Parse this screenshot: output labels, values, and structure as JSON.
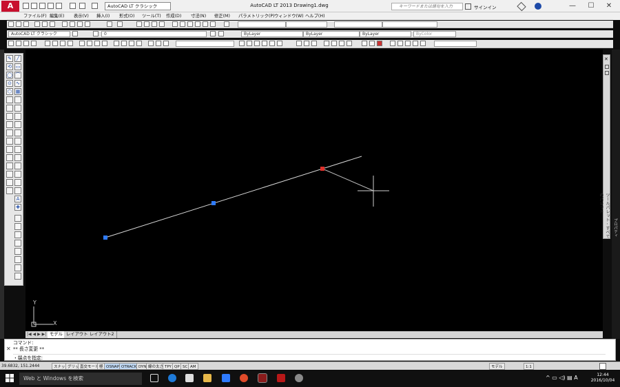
{
  "app": {
    "logo_label": "A",
    "workspace": "AutoCAD LT クラシック",
    "window_title": "AutoCAD LT 2013    Drawing1.dwg",
    "search_placeholder": "キーワードまたは語句を入力",
    "signin": "サインイン",
    "window_controls": [
      "—",
      "☐",
      "✕"
    ]
  },
  "menu": [
    "ファイル(F)",
    "編集(E)",
    "表示(V)",
    "挿入(I)",
    "形式(O)",
    "ツール(T)",
    "作成(D)",
    "寸法(N)",
    "修正(M)",
    "パラメトリック(P)",
    "ウィンドウ(W)",
    "ヘルプ(H)"
  ],
  "toolbar_row2": {
    "workspace": "AutoCAD LT クラシック",
    "layer": "0",
    "color": "ByLayer",
    "linetype": "ByLayer",
    "lineweight": "ByLayer",
    "plotstyle": "ByColor"
  },
  "left_tools": [
    "✎",
    "╱",
    "⟲",
    "▭",
    "◯",
    "⌒",
    "⊙",
    "∿",
    "⬡",
    "▦",
    "A",
    "✚"
  ],
  "drawing": {
    "ucs_y": "Y",
    "ucs_x": "X",
    "accent_line": "#d8d8d8",
    "grip_blue": "#2f7bff",
    "grip_red": "#e0302a"
  },
  "palette": {
    "close": "✕",
    "label": "ツールパレット - すべてのパレット"
  },
  "right_edge_label": "プロパティ",
  "layout_tabs": [
    "モデル",
    "レイアウト1",
    "レイアウト2"
  ],
  "command": {
    "history": [
      "コマンド:",
      "** 長さ変更 **"
    ],
    "prompt": "・端点を指定:",
    "close": "✕"
  },
  "status": {
    "coords": "39.6832, 151.2444",
    "toggles": [
      "スナップ",
      "グリッド",
      "直交モード",
      "極",
      "OSNAP",
      "OTRACK",
      "DYN",
      "線の太さ",
      "TPY",
      "QP",
      "SC",
      "AM"
    ],
    "active": [
      "OSNAP",
      "OTRACK"
    ],
    "right": [
      "モデル",
      "1:1"
    ]
  },
  "taskbar": {
    "search": "Web と Windows を検索",
    "time": "12:44",
    "date": "2016/10/04",
    "ime": "A"
  }
}
